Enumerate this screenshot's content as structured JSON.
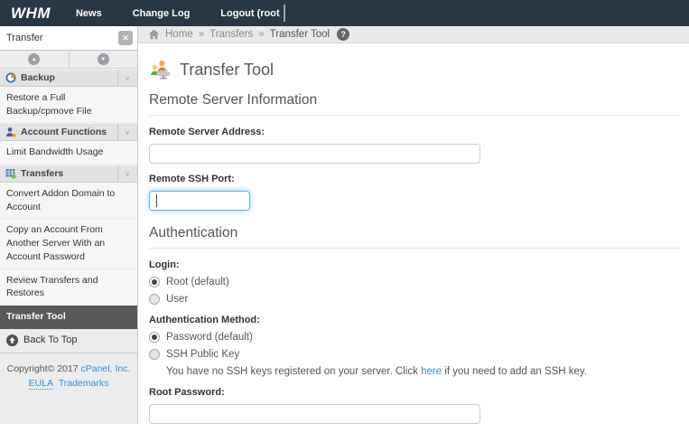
{
  "topbar": {
    "logo": "WHM",
    "nav": [
      {
        "label": "News"
      },
      {
        "label": "Change Log"
      },
      {
        "label": "Logout (root"
      }
    ]
  },
  "sidebar": {
    "search": {
      "value": "Transfer",
      "clear_icon": "✕"
    },
    "sections": [
      {
        "label": "Backup",
        "items": [
          "Restore a Full Backup/cpmove File"
        ]
      },
      {
        "label": "Account Functions",
        "items": [
          "Limit Bandwidth Usage"
        ]
      },
      {
        "label": "Transfers",
        "items": [
          "Convert Addon Domain to Account",
          "Copy an Account From Another Server With an Account Password",
          "Review Transfers and Restores",
          "Transfer Tool"
        ]
      }
    ],
    "back_to_top": "Back To Top",
    "copyright": {
      "prefix": "Copyright© 2017 ",
      "company": "cPanel, Inc.",
      "eula": "EULA",
      "trademarks": "Trademarks"
    }
  },
  "breadcrumb": {
    "separator": "»",
    "items": [
      "Home",
      "Transfers",
      "Transfer Tool"
    ],
    "help": "?"
  },
  "main": {
    "title": "Transfer Tool",
    "remote": {
      "heading": "Remote Server Information",
      "address_label": "Remote Server Address:",
      "port_label": "Remote SSH Port:"
    },
    "auth": {
      "heading": "Authentication",
      "login_label": "Login:",
      "login_options": [
        "Root (default)",
        "User"
      ],
      "method_label": "Authentication Method:",
      "method_options": [
        "Password (default)",
        "SSH Public Key"
      ],
      "ssh_note_pre": "You have no SSH keys registered on your server. Click ",
      "ssh_note_link": "here",
      "ssh_note_post": " if you need to add an SSH key.",
      "password_label": "Root Password:"
    }
  },
  "colors": {
    "topbar_bg": "#293744",
    "link_blue": "#2e93d6",
    "selected_item_bg": "#595959"
  }
}
